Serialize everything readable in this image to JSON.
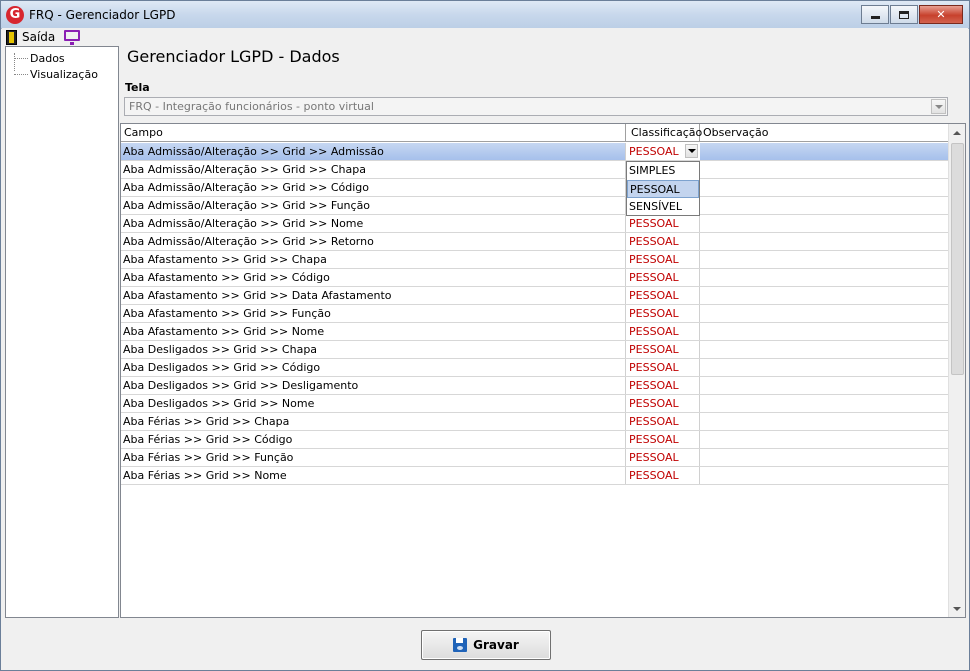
{
  "window": {
    "title": "FRQ - Gerenciador LGPD",
    "app_icon_letter": "G",
    "close_glyph": "✕"
  },
  "menubar": {
    "exit_label": "Saída",
    "exit_icon": "door-exit-icon",
    "second_icon": "monitor-icon"
  },
  "tree": {
    "items": [
      {
        "label": "Dados"
      },
      {
        "label": "Visualização"
      }
    ]
  },
  "main": {
    "title": "Gerenciador LGPD - Dados",
    "tela_label": "Tela",
    "tela_value": "FRQ - Integração funcionários - ponto virtual"
  },
  "grid": {
    "headers": {
      "campo": "Campo",
      "classificacao": "Classificação",
      "observacao": "Observação"
    },
    "rows": [
      {
        "campo": "Aba Admissão/Alteração >> Grid >> Admissão",
        "classificacao": "PESSOAL",
        "observacao": ""
      },
      {
        "campo": "Aba Admissão/Alteração >> Grid >> Chapa",
        "classificacao": "",
        "observacao": ""
      },
      {
        "campo": "Aba Admissão/Alteração >> Grid >> Código",
        "classificacao": "",
        "observacao": ""
      },
      {
        "campo": "Aba Admissão/Alteração >> Grid >> Função",
        "classificacao": "",
        "observacao": ""
      },
      {
        "campo": "Aba Admissão/Alteração >> Grid >> Nome",
        "classificacao": "PESSOAL",
        "observacao": ""
      },
      {
        "campo": "Aba Admissão/Alteração >> Grid >> Retorno",
        "classificacao": "PESSOAL",
        "observacao": ""
      },
      {
        "campo": "Aba Afastamento >> Grid >> Chapa",
        "classificacao": "PESSOAL",
        "observacao": ""
      },
      {
        "campo": "Aba Afastamento >> Grid >> Código",
        "classificacao": "PESSOAL",
        "observacao": ""
      },
      {
        "campo": "Aba Afastamento >> Grid >> Data Afastamento",
        "classificacao": "PESSOAL",
        "observacao": ""
      },
      {
        "campo": "Aba Afastamento >> Grid >> Função",
        "classificacao": "PESSOAL",
        "observacao": ""
      },
      {
        "campo": "Aba Afastamento >> Grid >> Nome",
        "classificacao": "PESSOAL",
        "observacao": ""
      },
      {
        "campo": "Aba Desligados >> Grid >> Chapa",
        "classificacao": "PESSOAL",
        "observacao": ""
      },
      {
        "campo": "Aba Desligados >> Grid >> Código",
        "classificacao": "PESSOAL",
        "observacao": ""
      },
      {
        "campo": "Aba Desligados >> Grid >> Desligamento",
        "classificacao": "PESSOAL",
        "observacao": ""
      },
      {
        "campo": "Aba Desligados >> Grid >> Nome",
        "classificacao": "PESSOAL",
        "observacao": ""
      },
      {
        "campo": "Aba Férias >> Grid >> Chapa",
        "classificacao": "PESSOAL",
        "observacao": ""
      },
      {
        "campo": "Aba Férias >> Grid >> Código",
        "classificacao": "PESSOAL",
        "observacao": ""
      },
      {
        "campo": "Aba Férias >> Grid >> Função",
        "classificacao": "PESSOAL",
        "observacao": ""
      },
      {
        "campo": "Aba Férias >> Grid >> Nome",
        "classificacao": "PESSOAL",
        "observacao": ""
      }
    ],
    "dropdown_options": [
      "SIMPLES",
      "PESSOAL",
      "SENSÍVEL"
    ],
    "dropdown_highlighted": "PESSOAL"
  },
  "footer": {
    "save_label": "Gravar",
    "save_icon": "floppy-disk-icon"
  },
  "colors": {
    "classification_text": "#c00000",
    "selected_row": "#a6c0eb"
  }
}
